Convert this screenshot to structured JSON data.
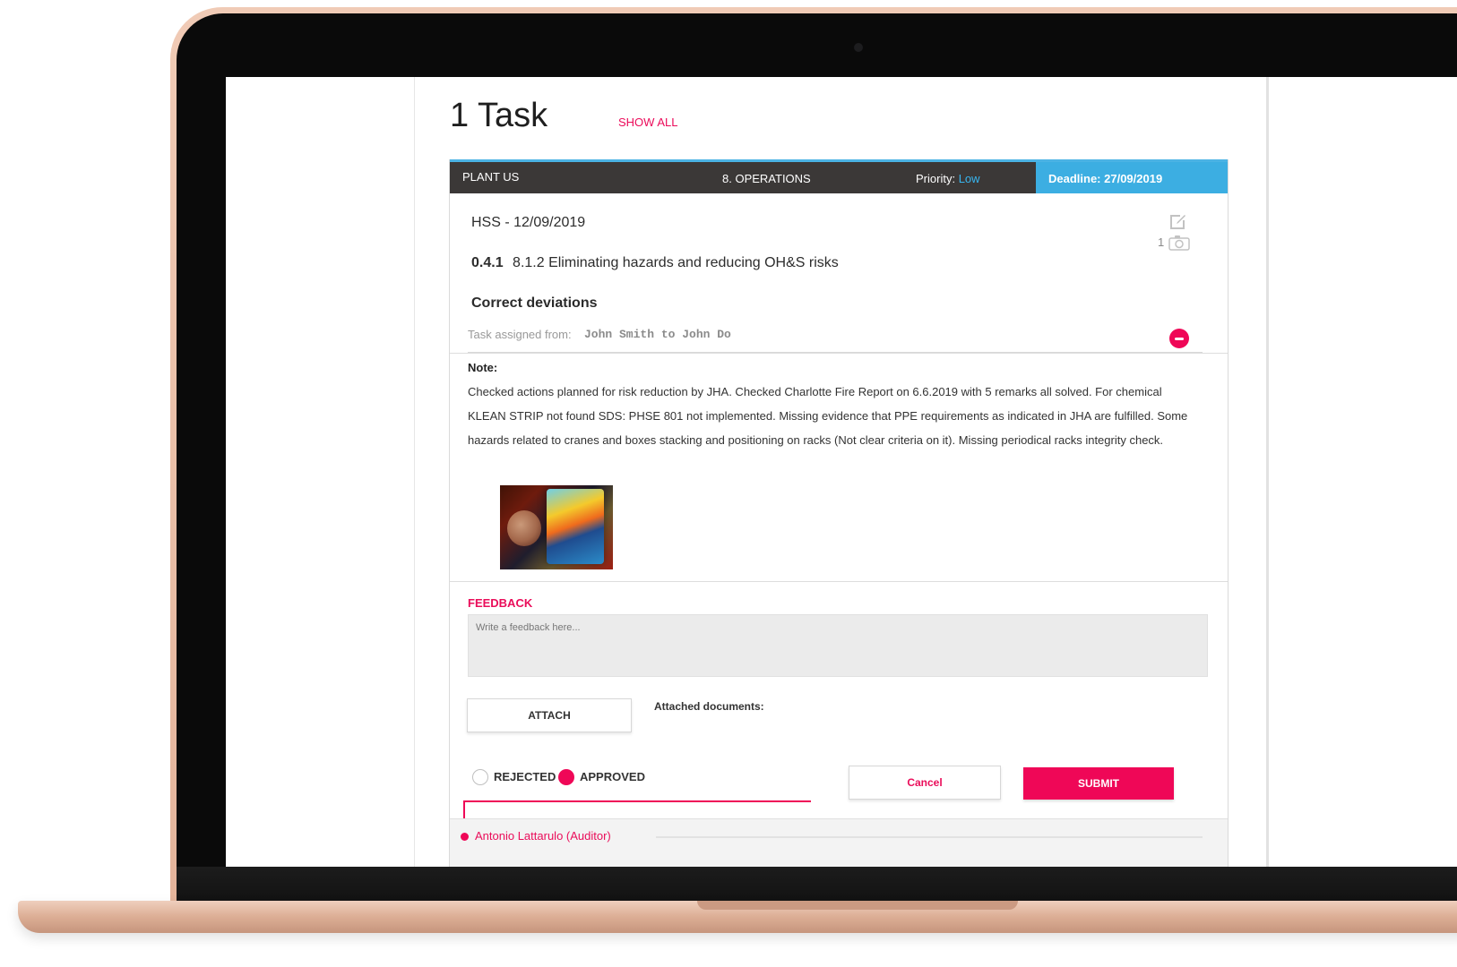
{
  "header": {
    "title": "1 Task",
    "show_all_label": "SHOW ALL"
  },
  "task_header": {
    "plant": "PLANT US",
    "operations": "8. OPERATIONS",
    "priority_label": "Priority:",
    "priority_value": "Low",
    "deadline": "Deadline: 27/09/2019"
  },
  "task": {
    "audit_line": "HSS - 12/09/2019",
    "photo_count": "1",
    "requirement_code": "0.4.1",
    "requirement_text": "8.1.2 Eliminating hazards and reducing OH&S risks",
    "deviation_title": "Correct deviations",
    "assigned_label": "Task assigned from:",
    "assigned_value": "John Smith to John Do",
    "note_label": "Note:",
    "note_text": "Checked actions planned for risk reduction by JHA. Checked Charlotte Fire Report on 6.6.2019 with 5 remarks all solved. For chemical KLEAN STRIP not found SDS: PHSE 801 not implemented. Missing evidence that PPE requirements as indicated in JHA are fulfilled. Some hazards related to cranes and boxes stacking and positioning on racks (Not clear criteria on it). Missing periodical racks integrity check."
  },
  "feedback": {
    "label": "FEEDBACK",
    "placeholder": "Write a feedback here...",
    "value": "",
    "attach_label": "ATTACH",
    "attached_documents_label": "Attached documents:"
  },
  "decision": {
    "rejected_label": "REJECTED",
    "approved_label": "APPROVED",
    "selected": "APPROVED",
    "cancel_label": "Cancel",
    "submit_label": "SUBMIT"
  },
  "history": {
    "first_auditor": "Antonio Lattarulo (Auditor)"
  },
  "icons": {
    "edit": "edit-icon",
    "camera": "camera-icon",
    "collapse": "minus-icon"
  },
  "colors": {
    "accent": "#EF0757",
    "deadline": "#3CAEE2",
    "header_dark": "#3B3837"
  }
}
